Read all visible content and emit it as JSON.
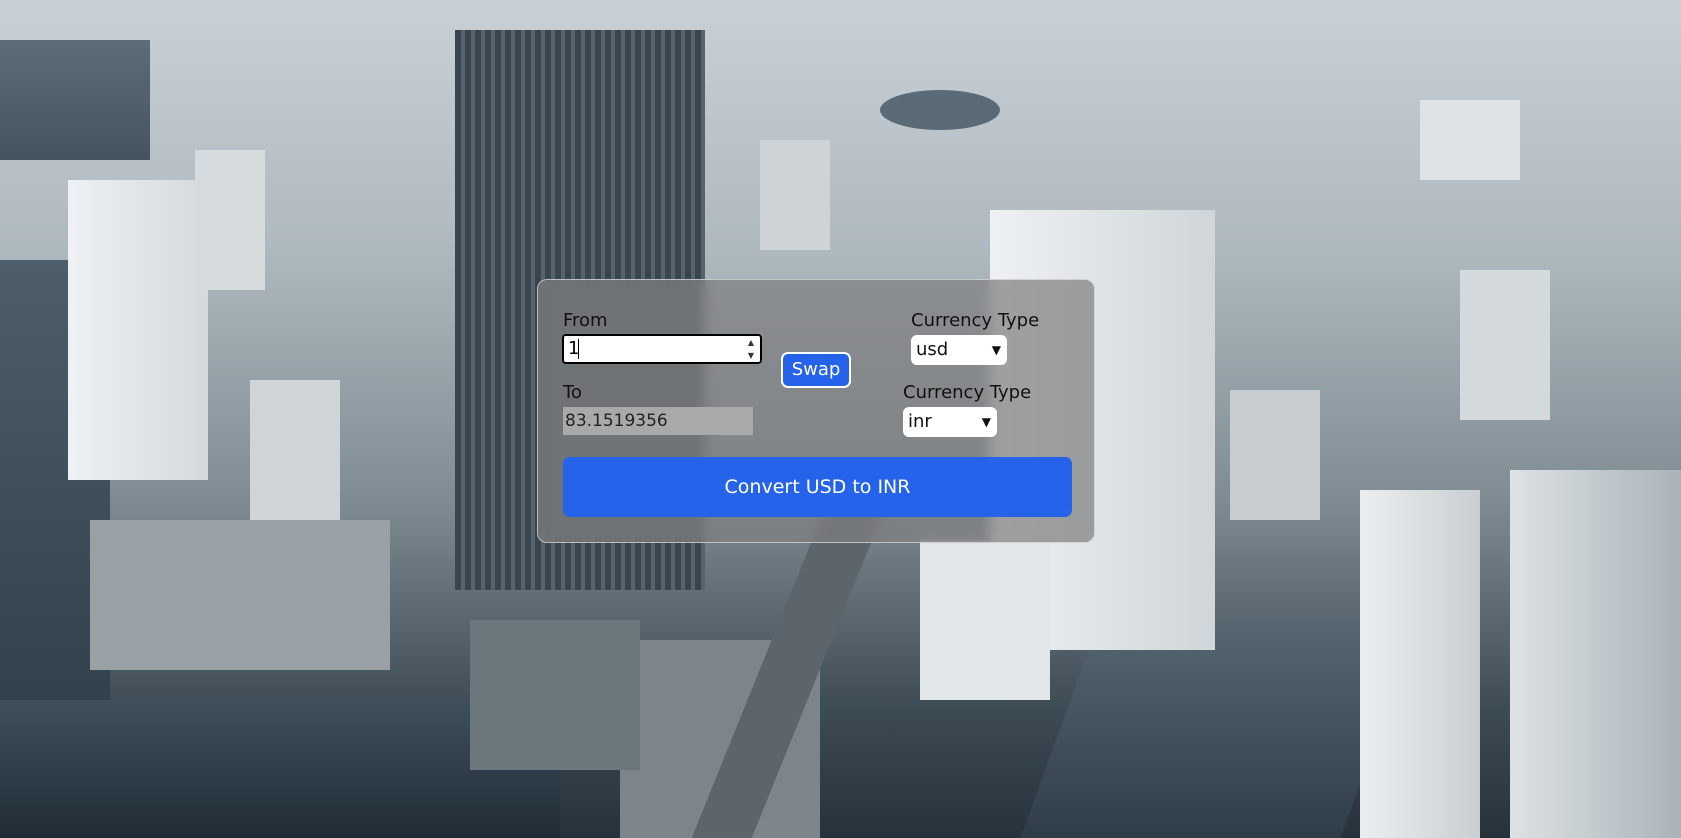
{
  "converter": {
    "from_label": "From",
    "to_label": "To",
    "from_value": "1",
    "to_value": "83.1519356",
    "swap_label": "Swap",
    "from_currency_label": "Currency Type",
    "to_currency_label": "Currency Type",
    "from_currency": "usd",
    "to_currency": "inr",
    "convert_label": "Convert USD to INR"
  },
  "colors": {
    "accent": "#2563eb",
    "card_bg": "rgba(128,128,128,0.72)"
  },
  "icons": {
    "select_arrow": "chevron-down-icon",
    "spinner_up": "caret-up-icon",
    "spinner_down": "caret-down-icon"
  }
}
